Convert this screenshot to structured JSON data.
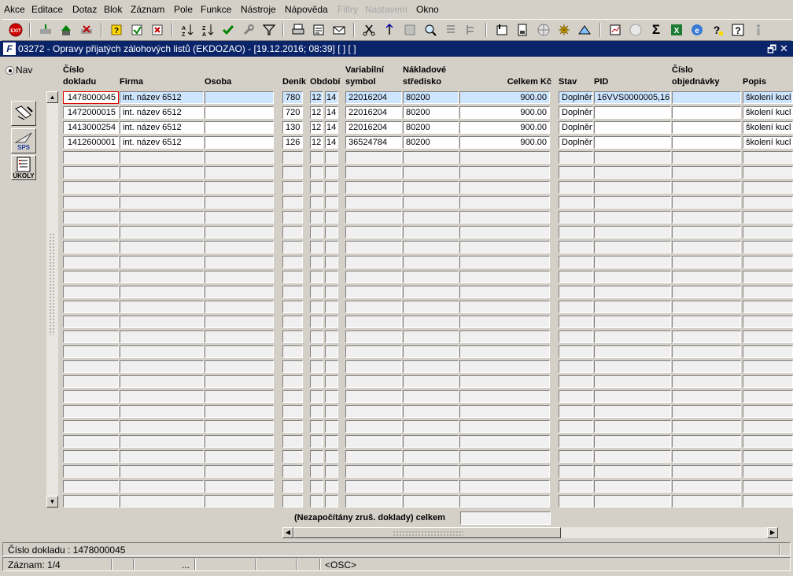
{
  "menu": [
    "Akce",
    "Editace",
    "Dotaz",
    "Blok",
    "Záznam",
    "Pole",
    "Funkce",
    "Nástroje",
    "Nápověda",
    "Filtry",
    "Nastavení",
    "Okno"
  ],
  "toolbar": {
    "exit_label": "EXIT",
    "icons": [
      "exit-icon",
      "sort-asc-icon",
      "sort-desc-icon",
      "check-icon",
      "wrench-icon",
      "filter-icon",
      "print-icon",
      "sigma-icon",
      "help-icon",
      "info-icon"
    ]
  },
  "window": {
    "icon_letter": "F",
    "title": "03272 - Opravy přijatých zálohových listů (EKDOZAO) - [19.12.2016; 08:39]  [ ]  [ ]",
    "restore_glyph": "🗗",
    "close_glyph": "✕"
  },
  "nav": {
    "label": "Nav"
  },
  "sidebar": {
    "sps_label": "SPS",
    "ukoly_label": "ÚKOLY"
  },
  "columns": [
    {
      "label1": "Číslo",
      "label2": "dokladu"
    },
    {
      "label1": "",
      "label2": "Firma"
    },
    {
      "label1": "",
      "label2": "Osoba"
    },
    {
      "label1": "",
      "label2": "Deník"
    },
    {
      "label1": "",
      "label2": "Období"
    },
    {
      "label1": "Variabilní",
      "label2": "symbol"
    },
    {
      "label1": "Nákladové",
      "label2": "středisko"
    },
    {
      "label1": "",
      "label2": "Celkem Kč"
    },
    {
      "label1": "",
      "label2": "Stav"
    },
    {
      "label1": "",
      "label2": "PID"
    },
    {
      "label1": "Číslo",
      "label2": "objednávky"
    },
    {
      "label1": "",
      "label2": "Popis"
    }
  ],
  "rows": [
    [
      "1478000045",
      "int. název 6512",
      "",
      "780",
      "12",
      "14",
      "22016204",
      "80200",
      "900.00",
      "Doplněn",
      "16VVS0000005,16'",
      "",
      "školení kucl"
    ],
    [
      "1472000015",
      "int. název 6512",
      "",
      "720",
      "12",
      "14",
      "22016204",
      "80200",
      "900.00",
      "Doplněn",
      "",
      "",
      "školení kucl"
    ],
    [
      "1413000254",
      "int. název 6512",
      "",
      "130",
      "12",
      "14",
      "22016204",
      "80200",
      "900.00",
      "Doplněn",
      "",
      "",
      "školení kucl"
    ],
    [
      "1412600001",
      "int. název 6512",
      "",
      "126",
      "12",
      "14",
      "36524784",
      "80200",
      "900.00",
      "Doplněn",
      "",
      "",
      "školení kucl"
    ]
  ],
  "empty_rows": 24,
  "footer": {
    "total_label": "(Nezapočítány zruš. doklady) celkem",
    "total_value": ""
  },
  "status": {
    "field_info": "Číslo dokladu : 1478000045",
    "record": "Záznam: 1/4",
    "ellipsis": "...",
    "osc": "<OSC>"
  }
}
